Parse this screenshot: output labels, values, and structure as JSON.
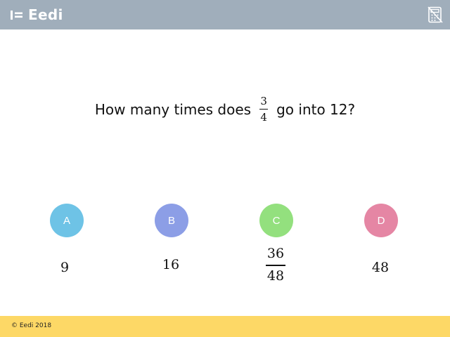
{
  "header": {
    "logo_text": "Eedi",
    "bg_color": "#a0aebb",
    "right_icon": "calculator-crossed-icon"
  },
  "question": {
    "text_before": "How many times does",
    "fraction_numerator": "3",
    "fraction_denominator": "4",
    "text_after": "go into 12?"
  },
  "options": [
    {
      "letter": "A",
      "color": "#6ec3e6",
      "answer": "9"
    },
    {
      "letter": "B",
      "color": "#8c9ee6",
      "answer": "16"
    },
    {
      "letter": "C",
      "color": "#93e07e",
      "answer_numerator": "36",
      "answer_denominator": "48"
    },
    {
      "letter": "D",
      "color": "#e586a4",
      "answer": "48"
    }
  ],
  "footer": {
    "text": "© Eedi 2018",
    "bg_color": "#fdd866"
  }
}
